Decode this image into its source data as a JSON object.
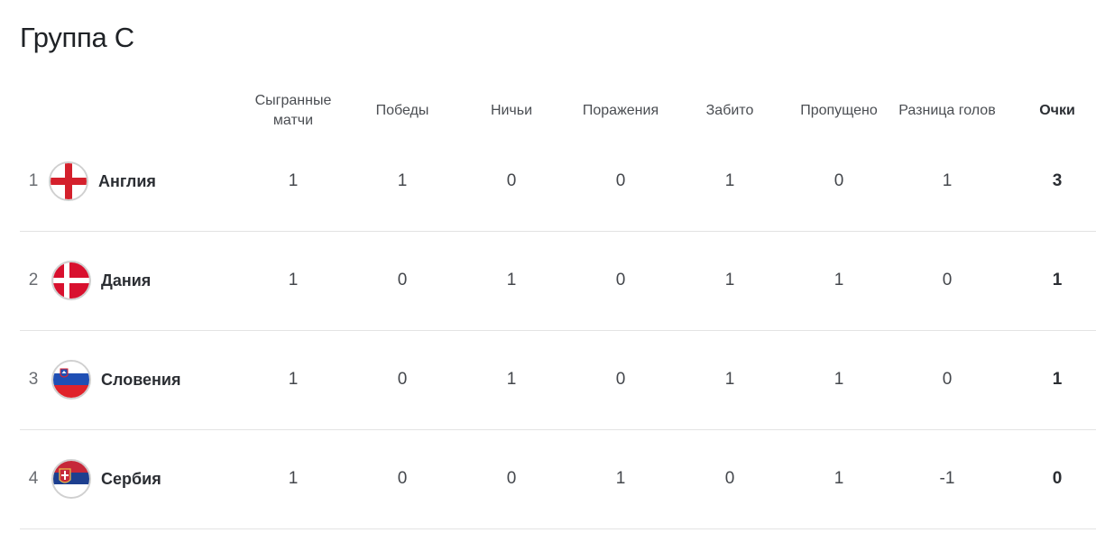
{
  "group_title": "Группа С",
  "columns": {
    "played": "Сыгранные матчи",
    "wins": "Победы",
    "draws": "Ничьи",
    "losses": "Поражения",
    "goals_for": "Забито",
    "goals_against": "Пропущено",
    "goal_diff": "Разница голов",
    "points": "Очки"
  },
  "rows": [
    {
      "rank": "1",
      "team": "Англия",
      "flag": "england-flag-icon",
      "played": "1",
      "wins": "1",
      "draws": "0",
      "losses": "0",
      "goals_for": "1",
      "goals_against": "0",
      "goal_diff": "1",
      "points": "3"
    },
    {
      "rank": "2",
      "team": "Дания",
      "flag": "denmark-flag-icon",
      "played": "1",
      "wins": "0",
      "draws": "1",
      "losses": "0",
      "goals_for": "1",
      "goals_against": "1",
      "goal_diff": "0",
      "points": "1"
    },
    {
      "rank": "3",
      "team": "Словения",
      "flag": "slovenia-flag-icon",
      "played": "1",
      "wins": "0",
      "draws": "1",
      "losses": "0",
      "goals_for": "1",
      "goals_against": "1",
      "goal_diff": "0",
      "points": "1"
    },
    {
      "rank": "4",
      "team": "Сербия",
      "flag": "serbia-flag-icon",
      "played": "1",
      "wins": "0",
      "draws": "0",
      "losses": "1",
      "goals_for": "0",
      "goals_against": "1",
      "goal_diff": "-1",
      "points": "0"
    }
  ]
}
